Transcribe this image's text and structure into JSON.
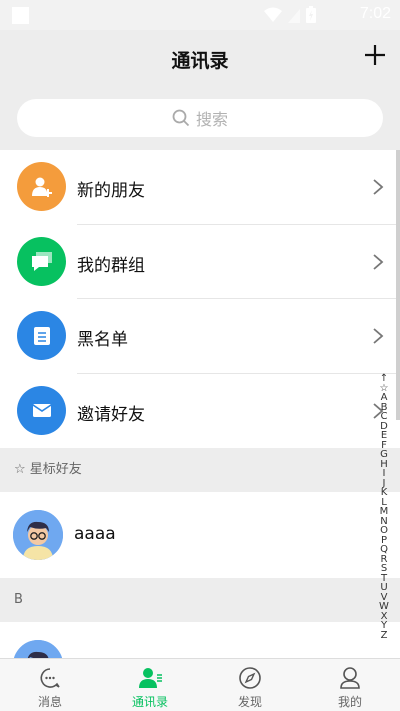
{
  "status_bar": {
    "time": "7:02"
  },
  "header": {
    "title": "通讯录"
  },
  "search": {
    "placeholder": "搜索"
  },
  "menu": [
    {
      "label": "新的朋友",
      "color": "#f49c3c",
      "icon": "add-friend-icon"
    },
    {
      "label": "我的群组",
      "color": "#07c160",
      "icon": "chat-bubbles-icon"
    },
    {
      "label": "黑名单",
      "color": "#2b86e4",
      "icon": "blacklist-icon"
    },
    {
      "label": "邀请好友",
      "color": "#2b86e4",
      "icon": "mail-icon"
    }
  ],
  "sections": {
    "starred": "☆ 星标好友",
    "b": "B"
  },
  "contacts": [
    {
      "name": "aaaa"
    }
  ],
  "index": [
    "↑",
    "☆",
    "A",
    "B",
    "C",
    "D",
    "E",
    "F",
    "G",
    "H",
    "I",
    "J",
    "K",
    "L",
    "M",
    "N",
    "O",
    "P",
    "Q",
    "R",
    "S",
    "T",
    "U",
    "V",
    "W",
    "X",
    "Y",
    "Z"
  ],
  "tabs": [
    {
      "label": "消息",
      "icon": "message-icon",
      "active": false
    },
    {
      "label": "通讯录",
      "icon": "contacts-icon",
      "active": true
    },
    {
      "label": "发现",
      "icon": "compass-icon",
      "active": false
    },
    {
      "label": "我的",
      "icon": "profile-icon",
      "active": false
    }
  ],
  "colors": {
    "accent": "#07c160",
    "background": "#ededed"
  }
}
